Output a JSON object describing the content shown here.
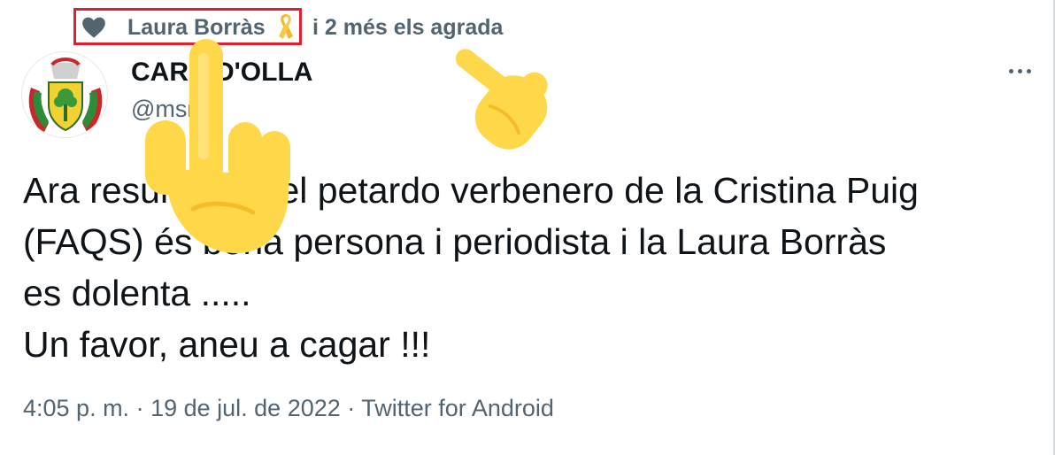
{
  "social_context": {
    "liker_name": "Laura Borràs",
    "rest": "i 2 més els agrada"
  },
  "author": {
    "name": "CARD D'OLLA",
    "handle": "@msrart"
  },
  "tweet": {
    "lines": [
      "Ara resulta que el petardo verbenero de la Cristina Puig",
      "(FAQS) és bona persona i periodista i la Laura Borràs",
      "es dolenta .....",
      "Un favor, aneu a cagar !!!"
    ]
  },
  "meta": {
    "time": "4:05 p. m.",
    "sep1": " · ",
    "date": "19 de jul. de 2022",
    "sep2": " · ",
    "client": "Twitter for Android"
  },
  "colors": {
    "secondary_text": "#536471",
    "highlight_border": "#e0202e",
    "emoji_yellow": "#ffd84a",
    "ribbon_yellow": "#f5b731"
  },
  "icons": [
    "heart-icon",
    "yellow-ribbon-icon",
    "more-options-icon",
    "pointing-hand-emoji",
    "pointing-up-hand-emoji"
  ]
}
